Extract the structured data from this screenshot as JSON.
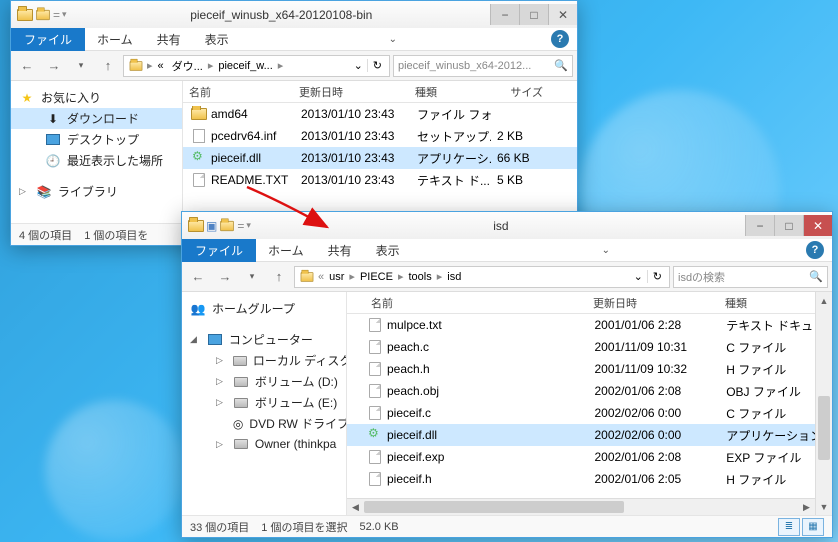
{
  "win1": {
    "title": "pieceif_winusb_x64-20120108-bin",
    "ribbon": {
      "file": "ファイル",
      "items": [
        "ホーム",
        "共有",
        "表示"
      ]
    },
    "breadcrumb": {
      "ellipsis": "«",
      "seg1": "ダウ...",
      "seg2": "pieceif_w...",
      "refresh": "↻"
    },
    "search_placeholder": "pieceif_winusb_x64-2012...",
    "nav": {
      "fav": "お気に入り",
      "downloads": "ダウンロード",
      "desktop": "デスクトップ",
      "recent": "最近表示した場所",
      "library": "ライブラリ"
    },
    "columns": {
      "name": "名前",
      "date": "更新日時",
      "kind": "種類",
      "size": "サイズ"
    },
    "files": [
      {
        "name": "amd64",
        "date": "2013/01/10 23:43",
        "kind": "ファイル フォ...",
        "size": "",
        "type": "folder"
      },
      {
        "name": "pcedrv64.inf",
        "date": "2013/01/10 23:43",
        "kind": "セットアップ...",
        "size": "2 KB",
        "type": "inf"
      },
      {
        "name": "pieceif.dll",
        "date": "2013/01/10 23:43",
        "kind": "アプリケーシ...",
        "size": "66 KB",
        "type": "dll",
        "selected": true
      },
      {
        "name": "README.TXT",
        "date": "2013/01/10 23:43",
        "kind": "テキスト ド...",
        "size": "5 KB",
        "type": "txt"
      }
    ],
    "status": {
      "count": "4 個の項目",
      "sel": "1 個の項目を"
    }
  },
  "win2": {
    "title": "isd",
    "ribbon": {
      "file": "ファイル",
      "items": [
        "ホーム",
        "共有",
        "表示"
      ]
    },
    "breadcrumb": {
      "seg1": "usr",
      "seg2": "PIECE",
      "seg3": "tools",
      "seg4": "isd",
      "refresh": "↻"
    },
    "search_placeholder": "isdの検索",
    "nav": {
      "homegroup": "ホームグループ",
      "computer": "コンピューター",
      "localC": "ローカル ディスク (C",
      "volD": "ボリューム (D:)",
      "volE": "ボリューム (E:)",
      "dvd": "DVD RW ドライブ",
      "owner": "Owner (thinkpa"
    },
    "columns": {
      "name": "名前",
      "date": "更新日時",
      "kind": "種類"
    },
    "files": [
      {
        "name": "mulpce.txt",
        "date": "2001/01/06 2:28",
        "kind": "テキスト ドキュ"
      },
      {
        "name": "peach.c",
        "date": "2001/11/09 10:31",
        "kind": "C ファイル"
      },
      {
        "name": "peach.h",
        "date": "2001/11/09 10:32",
        "kind": "H ファイル"
      },
      {
        "name": "peach.obj",
        "date": "2002/01/06 2:08",
        "kind": "OBJ ファイル"
      },
      {
        "name": "pieceif.c",
        "date": "2002/02/06 0:00",
        "kind": "C ファイル"
      },
      {
        "name": "pieceif.dll",
        "date": "2002/02/06 0:00",
        "kind": "アプリケーション",
        "selected": true,
        "dll": true
      },
      {
        "name": "pieceif.exp",
        "date": "2002/01/06 2:08",
        "kind": "EXP ファイル"
      },
      {
        "name": "pieceif.h",
        "date": "2002/01/06 2:05",
        "kind": "H ファイル"
      }
    ],
    "status": {
      "count": "33 個の項目",
      "sel": "1 個の項目を選択",
      "size": "52.0 KB"
    }
  }
}
